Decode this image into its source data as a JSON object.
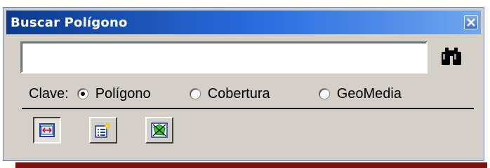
{
  "window": {
    "title": "Buscar Polígono",
    "title_bar_color": "#2a6ee0",
    "close_icon": "close-icon"
  },
  "search": {
    "value": "",
    "placeholder": "",
    "find_icon": "binoculars-icon"
  },
  "clave": {
    "label": "Clave:",
    "options": [
      {
        "label": "Polígono",
        "checked": true
      },
      {
        "label": "Cobertura",
        "checked": false
      },
      {
        "label": "GeoMedia",
        "checked": false
      }
    ]
  },
  "toolbar": {
    "buttons": [
      {
        "icon": "zoom-extent-icon",
        "pressed": true
      },
      {
        "icon": "add-list-icon",
        "pressed": false
      },
      {
        "icon": "polygon-select-icon",
        "pressed": false
      }
    ]
  }
}
